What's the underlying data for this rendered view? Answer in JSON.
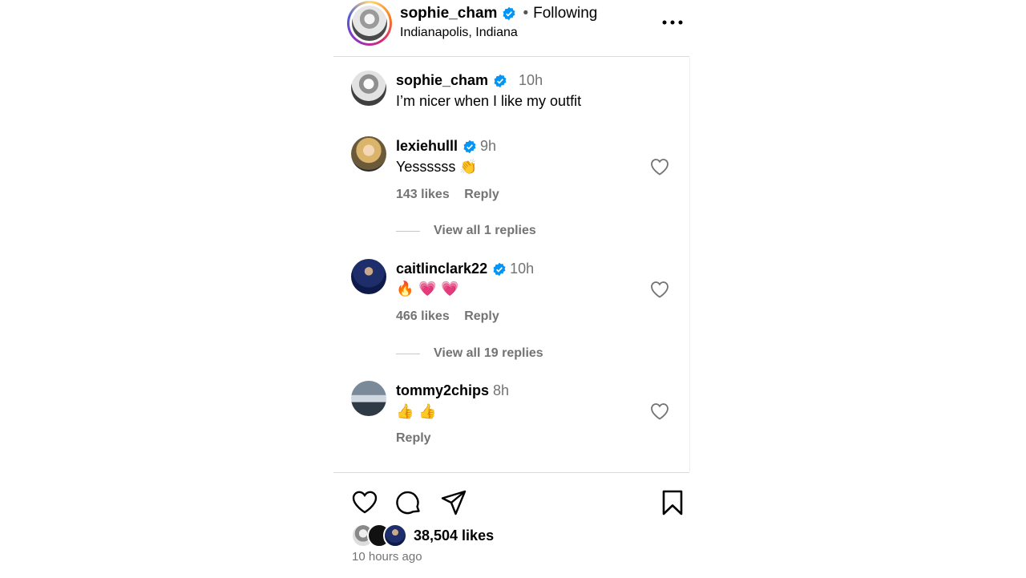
{
  "post": {
    "author": "sophie_cham",
    "follow_status": "Following",
    "separator": "•",
    "location": "Indianapolis, Indiana"
  },
  "caption": {
    "username": "sophie_cham",
    "time": "10h",
    "text": "I’m nicer when I like my outfit"
  },
  "comments": [
    {
      "username": "lexiehulll",
      "verified": true,
      "time": "9h",
      "text": "Yessssss",
      "emoji": "👏",
      "likes": "143 likes",
      "reply_label": "Reply",
      "view_replies": "View all 1 replies"
    },
    {
      "username": "caitlinclark22",
      "verified": true,
      "time": "10h",
      "text": "",
      "emoji": "🔥 💗 💗",
      "likes": "466 likes",
      "reply_label": "Reply",
      "view_replies": "View all 19 replies"
    },
    {
      "username": "tommy2chips",
      "verified": false,
      "time": "8h",
      "text": "",
      "emoji": "👍 👍",
      "likes": "",
      "reply_label": "Reply",
      "view_replies": ""
    }
  ],
  "footer": {
    "likes": "38,504 likes",
    "time_ago": "10 hours ago"
  },
  "colors": {
    "verified": "#0095f6",
    "muted": "#737373",
    "border": "#dbdbdb"
  },
  "icons": [
    "more-icon",
    "verified-icon",
    "heart-icon",
    "comment-icon",
    "share-icon",
    "bookmark-icon"
  ]
}
